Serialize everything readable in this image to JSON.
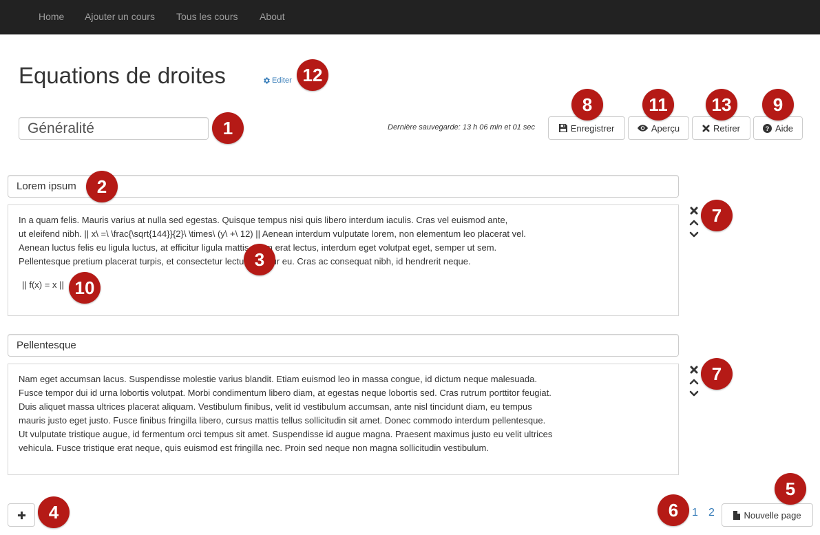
{
  "nav": {
    "items": [
      "Home",
      "Ajouter un cours",
      "Tous les cours",
      "About"
    ]
  },
  "page": {
    "title": "Equations de droites",
    "edit_label": "Editer",
    "page_name_value": "Généralité",
    "last_save": "Dernière sauvegarde: 13 h 06 min et 01 sec"
  },
  "toolbar": {
    "save_label": "Enregistrer",
    "preview_label": "Aperçu",
    "remove_label": "Retirer",
    "help_label": "Aide"
  },
  "sections": [
    {
      "title": "Lorem ipsum",
      "lines": [
        "In a quam felis. Mauris varius at nulla sed egestas. Quisque tempus nisi quis libero interdum iaculis. Cras vel euismod ante,",
        "ut eleifend nibh. || x\\ =\\ \\frac{\\sqrt{144}}{2}\\ \\times\\ (y\\ +\\ 12) || Aenean interdum vulputate lorem, non elementum leo placerat vel.",
        "Aenean luctus felis eu ligula luctus, at efficitur ligula mattis. Nam erat lectus, interdum eget volutpat eget, semper ut sem.",
        "Pellentesque pretium placerat turpis, et consectetur lectus efficitur eu. Cras ac consequat nibh, id hendrerit neque."
      ],
      "formula": "|| f(x) = x ||"
    },
    {
      "title": "Pellentesque",
      "lines": [
        "Nam eget accumsan lacus. Suspendisse molestie varius blandit. Etiam euismod leo in massa congue, id dictum neque malesuada.",
        "Fusce tempor dui id urna lobortis volutpat. Morbi condimentum libero diam, at egestas neque lobortis sed. Cras rutrum porttitor feugiat.",
        "Duis aliquet massa ultrices placerat aliquam. Vestibulum finibus, velit id vestibulum accumsan, ante nisl tincidunt diam, eu tempus",
        "mauris justo eget justo. Fusce finibus fringilla libero, cursus mattis tellus sollicitudin sit amet. Donec commodo interdum pellentesque.",
        "Ut vulputate tristique augue, id fermentum orci tempus sit amet. Suspendisse id augue magna. Praesent maximus justo eu velit ultrices",
        "vehicula. Fusce tristique erat neque, quis euismod est fringilla nec. Proin sed neque non magna sollicitudin vestibulum."
      ]
    }
  ],
  "pagination": {
    "pages": [
      "1",
      "2"
    ]
  },
  "footer": {
    "new_page_label": "Nouvelle page"
  },
  "badges": [
    "1",
    "2",
    "3",
    "4",
    "5",
    "6",
    "7",
    "7",
    "8",
    "9",
    "10",
    "11",
    "12",
    "13"
  ],
  "colors": {
    "navbar": "#222222",
    "badge": "#b51a16",
    "link": "#337ab7"
  }
}
